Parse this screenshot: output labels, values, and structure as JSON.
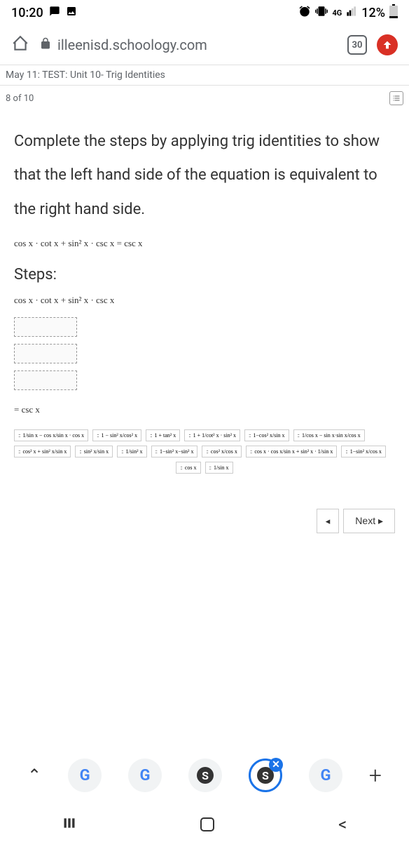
{
  "status": {
    "time": "10:20",
    "battery": "12%",
    "network": "4G"
  },
  "browser": {
    "url": "illeenisd.schoology.com",
    "tab_count": "30"
  },
  "breadcrumb": "May 11: TEST: Unit 10- Trig Identities",
  "question_counter": "8 of 10",
  "question": {
    "text": "Complete the steps by applying trig identities to show that the left hand side of the equation is equivalent to the right hand side.",
    "formula": "cos x · cot x + sin² x · csc x = csc x",
    "steps_label": "Steps:",
    "step_start": "cos x · cot x + sin² x · csc x",
    "result": "= csc x"
  },
  "tiles": {
    "row1": [
      "1/sin x − cos x/sin x · cos x",
      "1 − sin² x/cos² x",
      "1 + tan² x",
      "1 + 1/cot² x · sin² x",
      "1−cos² x/sin x",
      "1/cos x − sin x·sin x/cos x"
    ],
    "row2": [
      "cos² x + sin² x/sin x",
      "sin² x/sin x",
      "1/sin² x",
      "1−sin² x−sin² x",
      "cos² x/cos x",
      "cos x · cos x/sin x + sin² x · 1/sin x",
      "1−sin² x/cos x"
    ],
    "row3": [
      "cos x",
      "1/sin x"
    ]
  },
  "nav": {
    "prev": "◂",
    "next": "Next ▸"
  }
}
